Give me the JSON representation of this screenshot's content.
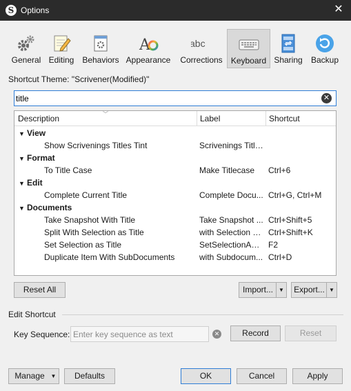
{
  "window": {
    "title": "Options",
    "app_icon": "S"
  },
  "toolbar": {
    "items": [
      {
        "label": "General",
        "icon": "gears-icon"
      },
      {
        "label": "Editing",
        "icon": "pencil-note-icon"
      },
      {
        "label": "Behaviors",
        "icon": "window-gear-icon"
      },
      {
        "label": "Appearance",
        "icon": "font-color-icon"
      },
      {
        "label": "Corrections",
        "icon": "abc-icon"
      },
      {
        "label": "Keyboard",
        "icon": "keyboard-icon",
        "active": true
      },
      {
        "label": "Sharing",
        "icon": "sharing-icon"
      },
      {
        "label": "Backup",
        "icon": "backup-icon"
      }
    ]
  },
  "theme_label": "Shortcut Theme: \"Scrivener(Modified)\"",
  "search": {
    "value": "title"
  },
  "table": {
    "columns": [
      "Description",
      "Label",
      "Shortcut"
    ],
    "groups": [
      {
        "name": "View",
        "rows": [
          {
            "description": "Show Scrivenings Titles Tint",
            "label": "Scrivenings Titles",
            "shortcut": ""
          }
        ]
      },
      {
        "name": "Format",
        "rows": [
          {
            "description": "To Title Case",
            "label": "Make Titlecase",
            "shortcut": "Ctrl+6"
          }
        ]
      },
      {
        "name": "Edit",
        "rows": [
          {
            "description": "Complete Current Title",
            "label": "Complete Docu...",
            "shortcut": "Ctrl+G, Ctrl+M"
          }
        ]
      },
      {
        "name": "Documents",
        "rows": [
          {
            "description": "Take Snapshot With Title",
            "label": "Take Snapshot ...",
            "shortcut": "Ctrl+Shift+5"
          },
          {
            "description": "Split With Selection as Title",
            "label": "with Selection a...",
            "shortcut": "Ctrl+Shift+K"
          },
          {
            "description": "Set Selection as Title",
            "label": "SetSelectionAsT...",
            "shortcut": "F2"
          },
          {
            "description": "Duplicate Item With SubDocuments",
            "label": "with Subdocum...",
            "shortcut": "Ctrl+D"
          }
        ]
      }
    ]
  },
  "buttons": {
    "reset_all": "Reset All",
    "import": "Import...",
    "export": "Export...",
    "record": "Record",
    "reset": "Reset",
    "manage": "Manage",
    "defaults": "Defaults",
    "ok": "OK",
    "cancel": "Cancel",
    "apply": "Apply"
  },
  "edit_shortcut": {
    "title": "Edit Shortcut",
    "key_sequence_label": "Key Sequence:",
    "placeholder": "Enter key sequence as text"
  },
  "colors": {
    "accent": "#2f7dd6",
    "titlebar": "#2b2b2b"
  }
}
